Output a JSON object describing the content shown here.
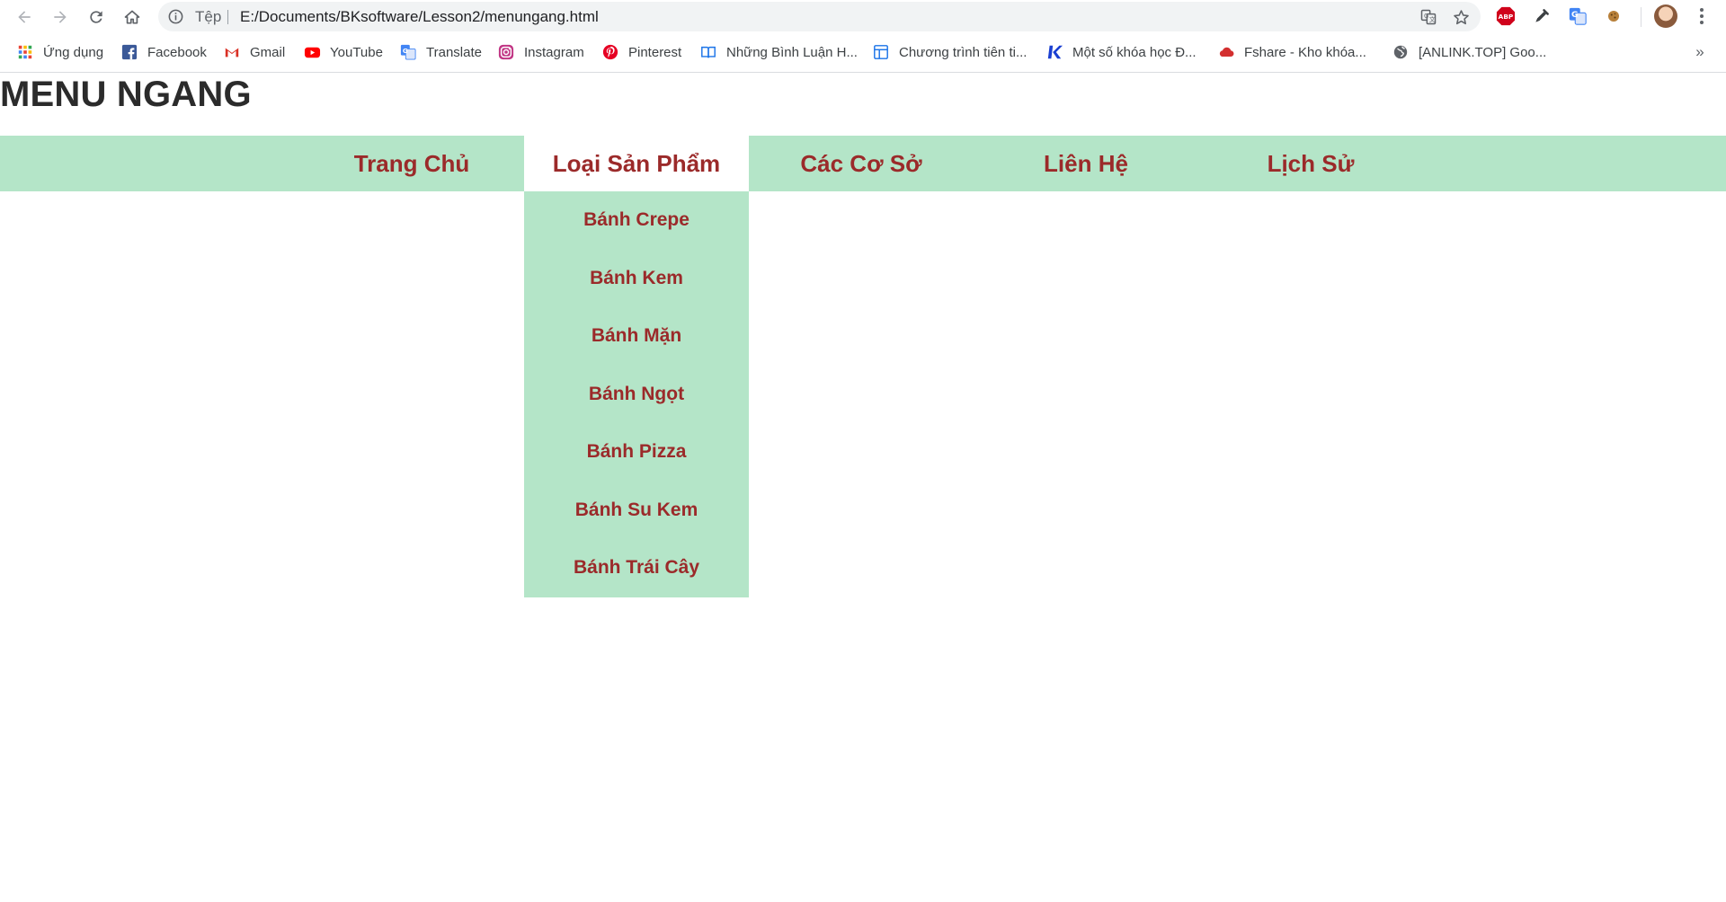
{
  "browser": {
    "scheme_label": "Tệp",
    "url": "E:/Documents/BKsoftware/Lesson2/menungang.html",
    "nav_icons": [
      "back-arrow-icon",
      "forward-arrow-icon",
      "reload-icon",
      "home-icon"
    ],
    "extension_icons": [
      "translate-page-icon",
      "bookmark-star-icon",
      "adblock-plus-icon",
      "eyedropper-icon",
      "google-translate-icon",
      "cookie-icon"
    ],
    "adblock_label": "ABP"
  },
  "bookmarks": [
    {
      "label": "Ứng dụng",
      "icon": "apps-grid-icon"
    },
    {
      "label": "Facebook",
      "icon": "facebook-icon"
    },
    {
      "label": "Gmail",
      "icon": "gmail-icon"
    },
    {
      "label": "YouTube",
      "icon": "youtube-icon"
    },
    {
      "label": "Translate",
      "icon": "translate-icon"
    },
    {
      "label": "Instagram",
      "icon": "instagram-icon"
    },
    {
      "label": "Pinterest",
      "icon": "pinterest-icon"
    },
    {
      "label": "Những Bình Luận H...",
      "icon": "book-icon"
    },
    {
      "label": "Chương trình tiên ti...",
      "icon": "layout-icon"
    },
    {
      "label": "Một số khóa học Đ...",
      "icon": "k-logo-icon"
    },
    {
      "label": "Fshare - Kho khóa...",
      "icon": "cloud-icon"
    },
    {
      "label": "[ANLINK.TOP] Goo...",
      "icon": "globe-icon"
    }
  ],
  "bookmarks_overflow": "»",
  "page": {
    "title": "MENU NGANG",
    "menu": [
      "Trang Chủ",
      "Loại Sản Phẩm",
      "Các Cơ Sở",
      "Liên Hệ",
      "Lịch Sử"
    ],
    "active_menu": "Loại Sản Phẩm",
    "submenu": [
      "Bánh Crepe",
      "Bánh Kem",
      "Bánh Mặn",
      "Bánh Ngọt",
      "Bánh Pizza",
      "Bánh Su Kem",
      "Bánh Trái Cây"
    ]
  },
  "colors": {
    "menu_bg": "#b4e5c8",
    "menu_text": "#9b2a2a",
    "active_bg": "#ffffff",
    "title_text": "#2b2b2b"
  }
}
